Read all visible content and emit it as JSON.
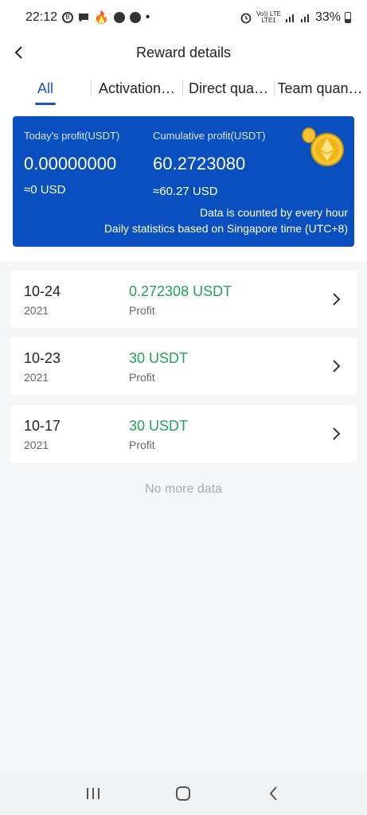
{
  "status_bar": {
    "time": "22:12",
    "battery": "33%",
    "network_top": "Vo)) LTE",
    "network_bottom": "LTE1"
  },
  "header": {
    "title": "Reward details",
    "back_icon": "chevron-left-icon"
  },
  "tabs": [
    {
      "label": "All",
      "active": true
    },
    {
      "label": "Activation…",
      "active": false
    },
    {
      "label": "Direct qua…",
      "active": false
    },
    {
      "label": "Team quan…",
      "active": false
    }
  ],
  "profit_card": {
    "today_label": "Today's profit(USDT)",
    "today_value": "0.00000000",
    "today_usd": "≈0 USD",
    "cumulative_label": "Cumulative profit(USDT)",
    "cumulative_value": "60.2723080",
    "cumulative_usd": "≈60.27 USD",
    "note_1": "Data is counted by every hour",
    "note_2": "Daily statistics based on Singapore time (UTC+8)",
    "background_color": "#0a4fbf",
    "coin_icon": "ethereum-coin-icon"
  },
  "records": [
    {
      "date": "10-24",
      "year": "2021",
      "amount": "0.272308 USDT",
      "label": "Profit"
    },
    {
      "date": "10-23",
      "year": "2021",
      "amount": "30 USDT",
      "label": "Profit"
    },
    {
      "date": "10-17",
      "year": "2021",
      "amount": "30 USDT",
      "label": "Profit"
    }
  ],
  "footer_text": "No more data",
  "colors": {
    "accent": "#1a53c7",
    "profit_green": "#25a05e"
  }
}
